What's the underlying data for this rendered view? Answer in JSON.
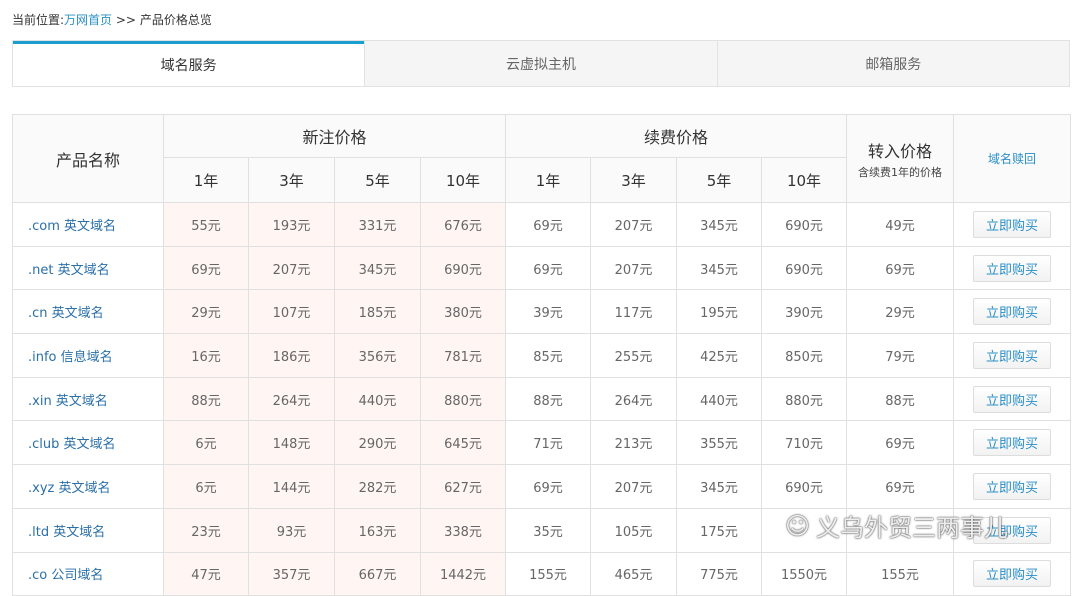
{
  "breadcrumb": {
    "prefix": "当前位置:",
    "home": "万网首页",
    "sep": " >> ",
    "current": "产品价格总览"
  },
  "tabs": [
    "域名服务",
    "云虚拟主机",
    "邮箱服务"
  ],
  "header": {
    "name": "产品名称",
    "new": "新注价格",
    "renew": "续费价格",
    "transfer": "转入价格",
    "transfer_note": "含续费1年的价格",
    "redeem": "域名赎回",
    "years": [
      "1年",
      "3年",
      "5年",
      "10年"
    ]
  },
  "buy_label": "立即购买",
  "rows": [
    {
      "name": ".com 英文域名",
      "new": [
        "55元",
        "193元",
        "331元",
        "676元"
      ],
      "renew": [
        "69元",
        "207元",
        "345元",
        "690元"
      ],
      "transfer": "49元"
    },
    {
      "name": ".net 英文域名",
      "new": [
        "69元",
        "207元",
        "345元",
        "690元"
      ],
      "renew": [
        "69元",
        "207元",
        "345元",
        "690元"
      ],
      "transfer": "69元"
    },
    {
      "name": ".cn 英文域名",
      "new": [
        "29元",
        "107元",
        "185元",
        "380元"
      ],
      "renew": [
        "39元",
        "117元",
        "195元",
        "390元"
      ],
      "transfer": "29元"
    },
    {
      "name": ".info 信息域名",
      "new": [
        "16元",
        "186元",
        "356元",
        "781元"
      ],
      "renew": [
        "85元",
        "255元",
        "425元",
        "850元"
      ],
      "transfer": "79元"
    },
    {
      "name": ".xin 英文域名",
      "new": [
        "88元",
        "264元",
        "440元",
        "880元"
      ],
      "renew": [
        "88元",
        "264元",
        "440元",
        "880元"
      ],
      "transfer": "88元"
    },
    {
      "name": ".club 英文域名",
      "new": [
        "6元",
        "148元",
        "290元",
        "645元"
      ],
      "renew": [
        "71元",
        "213元",
        "355元",
        "710元"
      ],
      "transfer": "69元"
    },
    {
      "name": ".xyz 英文域名",
      "new": [
        "6元",
        "144元",
        "282元",
        "627元"
      ],
      "renew": [
        "69元",
        "207元",
        "345元",
        "690元"
      ],
      "transfer": "69元"
    },
    {
      "name": ".ltd 英文域名",
      "new": [
        "23元",
        "93元",
        "163元",
        "338元"
      ],
      "renew": [
        "35元",
        "105元",
        "175元",
        ""
      ],
      "transfer": ""
    },
    {
      "name": ".co 公司域名",
      "new": [
        "47元",
        "357元",
        "667元",
        "1442元"
      ],
      "renew": [
        "155元",
        "465元",
        "775元",
        "1550元"
      ],
      "transfer": "155元"
    }
  ],
  "watermark": "义乌外贸三两事儿"
}
